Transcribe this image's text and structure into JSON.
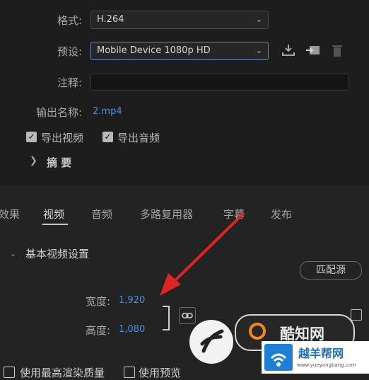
{
  "export": {
    "format_label": "格式:",
    "format_value": "H.264",
    "preset_label": "预设:",
    "preset_value": "Mobile Device 1080p HD",
    "comments_label": "注释:",
    "comments_value": "",
    "output_name_label": "输出名称:",
    "output_name_value": "2.mp4",
    "export_video_label": "导出视频",
    "export_audio_label": "导出音频",
    "summary_label": "摘 要"
  },
  "tabs": [
    {
      "label": "效果",
      "active": false
    },
    {
      "label": "视频",
      "active": true
    },
    {
      "label": "音频",
      "active": false
    },
    {
      "label": "多路复用器",
      "active": false
    },
    {
      "label": "字幕",
      "active": false
    },
    {
      "label": "发布",
      "active": false
    }
  ],
  "video_settings": {
    "section_title": "基本视频设置",
    "match_source_label": "匹配源",
    "width_label": "宽度:",
    "width_value": "1,920",
    "height_label": "高度:",
    "height_value": "1,080"
  },
  "bottom": {
    "max_render_quality_label": "使用最高渲染质量",
    "use_previews_label": "使用预览"
  },
  "watermarks": {
    "brand1": "酷知网",
    "brand2": "越羊帮网",
    "brand2_url": "www.yueyangbang.com"
  },
  "colors": {
    "accent_link": "#4a90e2",
    "annotation_arrow": "#e02424"
  },
  "icons": [
    "chevron-down-icon",
    "save-preset-icon",
    "import-preset-icon",
    "trash-icon",
    "chevron-right-icon",
    "link-icon"
  ]
}
